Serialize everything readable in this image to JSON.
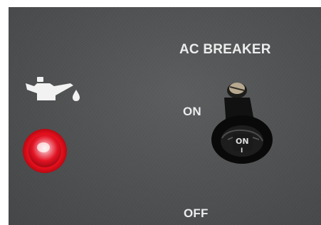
{
  "panel": {
    "title": "AC BREAKER",
    "on_label": "ON",
    "off_label": "OFF"
  },
  "indicators": {
    "oil_icon": "oil-can-icon",
    "warning_light_color": "#e2111c"
  },
  "breaker_switch": {
    "position": "ON",
    "face_text": "ON",
    "face_subtext": "I"
  },
  "colors": {
    "panel": "#505253",
    "text": "#ececec",
    "switch": "#111111"
  }
}
